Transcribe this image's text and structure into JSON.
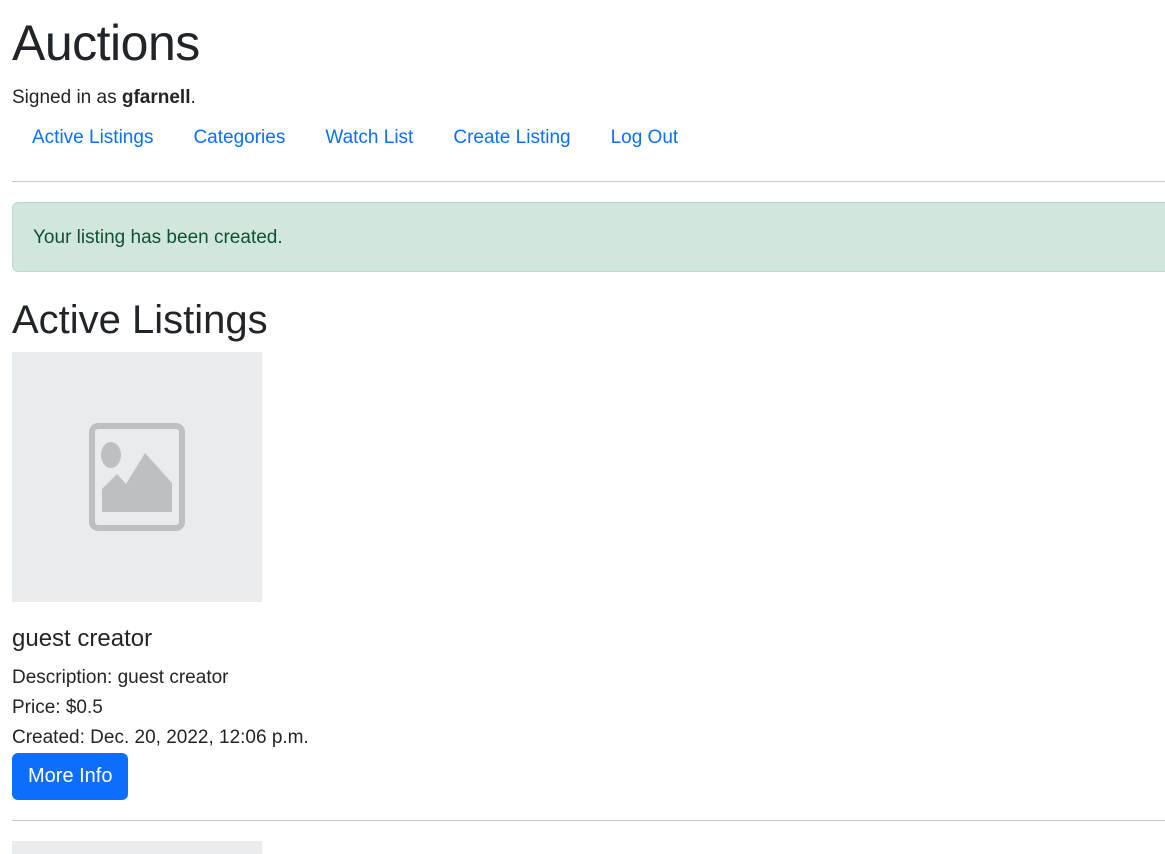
{
  "header": {
    "title": "Auctions",
    "signed_in_prefix": "Signed in as ",
    "username": "gfarnell",
    "signed_in_suffix": "."
  },
  "nav": {
    "items": [
      {
        "label": "Active Listings"
      },
      {
        "label": "Categories"
      },
      {
        "label": "Watch List"
      },
      {
        "label": "Create Listing"
      },
      {
        "label": "Log Out"
      }
    ]
  },
  "alert": {
    "message": "Your listing has been created.",
    "type": "success"
  },
  "main": {
    "heading": "Active Listings",
    "listings": [
      {
        "image_icon": "image-placeholder-icon",
        "title": "guest creator",
        "description": "Description: guest creator",
        "price": "Price: $0.5",
        "created": "Created: Dec. 20, 2022, 12:06 p.m.",
        "button_label": "More Info"
      }
    ]
  },
  "colors": {
    "link": "#0d6efd",
    "alert_bg": "#d1e7dd",
    "alert_text": "#0f5132",
    "placeholder_bg": "#e9ecef",
    "placeholder_icon": "#bcc0c3"
  }
}
